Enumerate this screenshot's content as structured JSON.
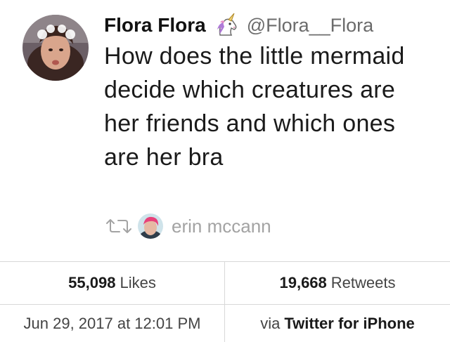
{
  "tweet": {
    "display_name": "Flora Flora",
    "handle": "@Flora__Flora",
    "badge_icon": "unicorn-icon",
    "text": "How does the little mermaid decide which creatures are her friends and which ones are her bra"
  },
  "social_context": {
    "icon": "retweet-icon",
    "name": "erin mccann"
  },
  "stats": {
    "likes_count": "55,098",
    "likes_label": "Likes",
    "retweets_count": "19,668",
    "retweets_label": "Retweets"
  },
  "footer": {
    "timestamp": "Jun 29, 2017 at 12:01 PM",
    "via_prefix": "via",
    "source": "Twitter for iPhone"
  },
  "colors": {
    "text": "#1a1a1a",
    "handle": "#6b6b6b",
    "muted": "#a3a3a3",
    "divider": "#d8d8d8"
  }
}
